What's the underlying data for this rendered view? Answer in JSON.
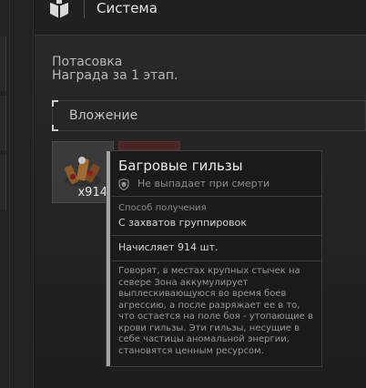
{
  "header": {
    "title": "Система",
    "icon": "box-icon"
  },
  "reward": {
    "event_name": "Потасовка",
    "reward_line": "Награда за 1 этап."
  },
  "attachment": {
    "label": "Вложение"
  },
  "item": {
    "count": "x914",
    "icon": "cartridges-icon"
  },
  "tooltip": {
    "title": "Багровые гильзы",
    "no_drop": "Не выпадает при смерти",
    "source_label": "Способ получения",
    "source_value": "С захватов группировок",
    "amount": "Начисляет 914 шт.",
    "description": "Говорят, в местах крупных стычек на севере Зона аккумулирует выплескивающуюся во время боев агрессию, а после разряжает ее в то, что остается на поле боя - утопающие в крови гильзы. Эти гильзы, несущие в себе частицы аномальной энергии, становятся ценным ресурсом."
  },
  "colors": {
    "background": "#1b1b1b",
    "tooltip_accent": "#a5a5a5",
    "slot_red": "#4a2525"
  }
}
